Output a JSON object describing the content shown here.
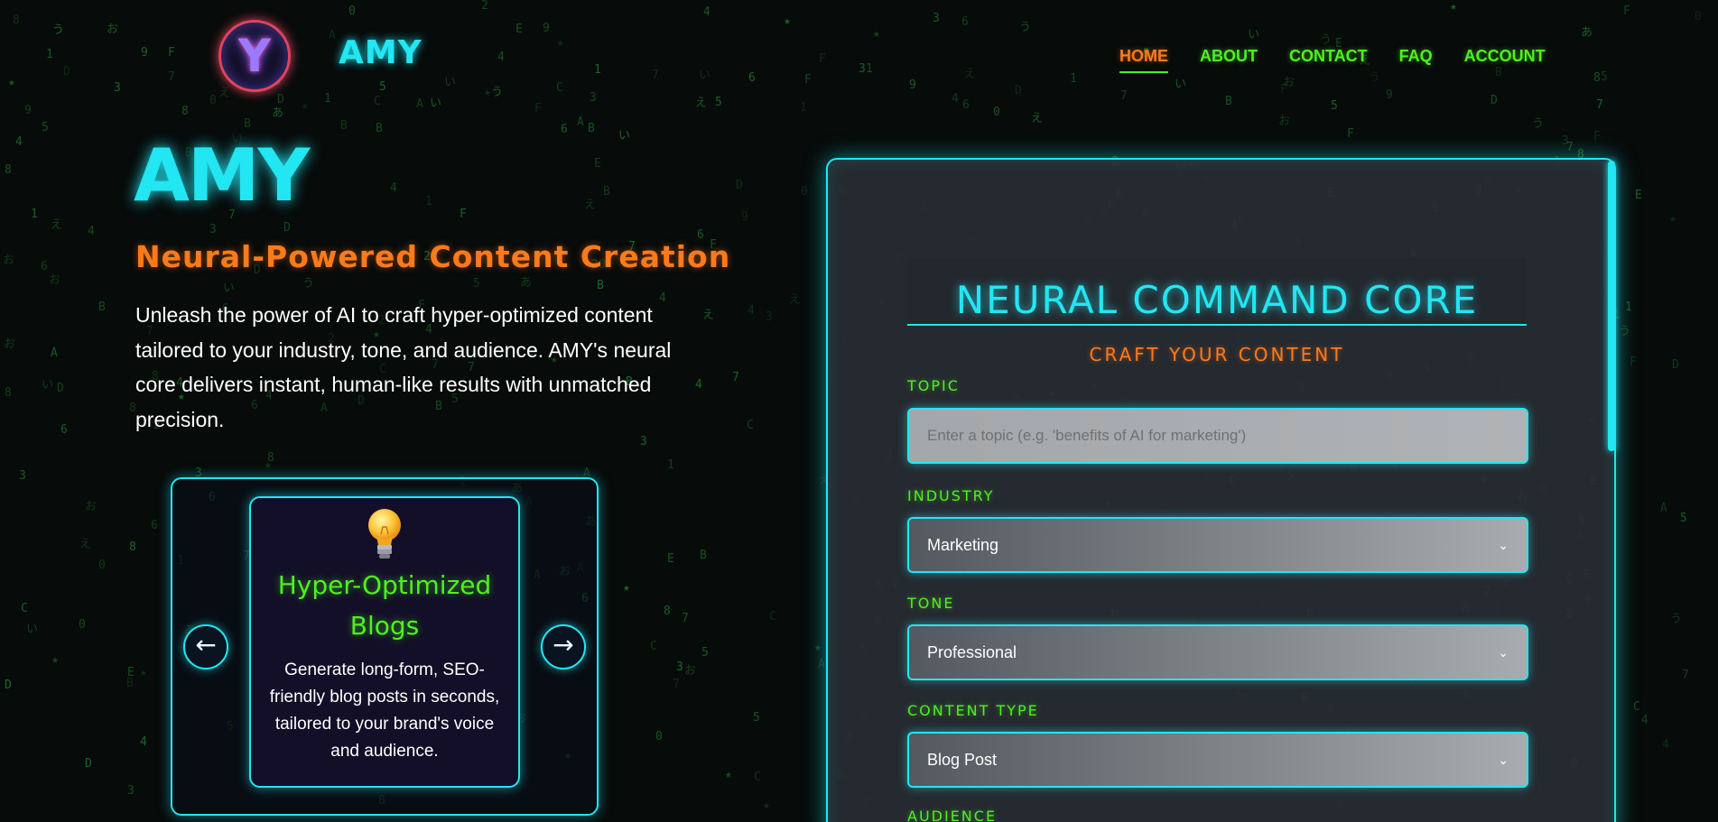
{
  "brand": {
    "logo_letter": "Y",
    "name": "AMY"
  },
  "nav": {
    "items": [
      {
        "label": "HOME",
        "active": true
      },
      {
        "label": "ABOUT",
        "active": false
      },
      {
        "label": "CONTACT",
        "active": false
      },
      {
        "label": "FAQ",
        "active": false
      },
      {
        "label": "ACCOUNT",
        "active": false
      }
    ]
  },
  "hero": {
    "title": "AMY",
    "subtitle": "Neural-Powered Content Creation",
    "description": "Unleash the power of AI to craft hyper-optimized content tailored to your industry, tone, and audience. AMY's neural core delivers instant, human-like results with unmatched precision."
  },
  "carousel": {
    "prev_label": "←",
    "next_label": "→",
    "card": {
      "icon": "lightbulb-icon",
      "title": "Hyper-Optimized Blogs",
      "description": "Generate long-form, SEO-friendly blog posts in seconds, tailored to your brand's voice and audience."
    }
  },
  "form": {
    "title": "NEURAL COMMAND CORE",
    "subtitle": "CRAFT YOUR CONTENT",
    "topic": {
      "label": "TOPIC",
      "placeholder": "Enter a topic (e.g. 'benefits of AI for marketing')"
    },
    "industry": {
      "label": "INDUSTRY",
      "value": "Marketing"
    },
    "tone": {
      "label": "TONE",
      "value": "Professional"
    },
    "content_type": {
      "label": "CONTENT TYPE",
      "value": "Blog Post"
    },
    "audience": {
      "label": "AUDIENCE"
    }
  },
  "colors": {
    "accent_cyan": "#22e6f2",
    "accent_green": "#4ff01f",
    "accent_orange": "#ff7a1a",
    "background": "#070b0a"
  }
}
